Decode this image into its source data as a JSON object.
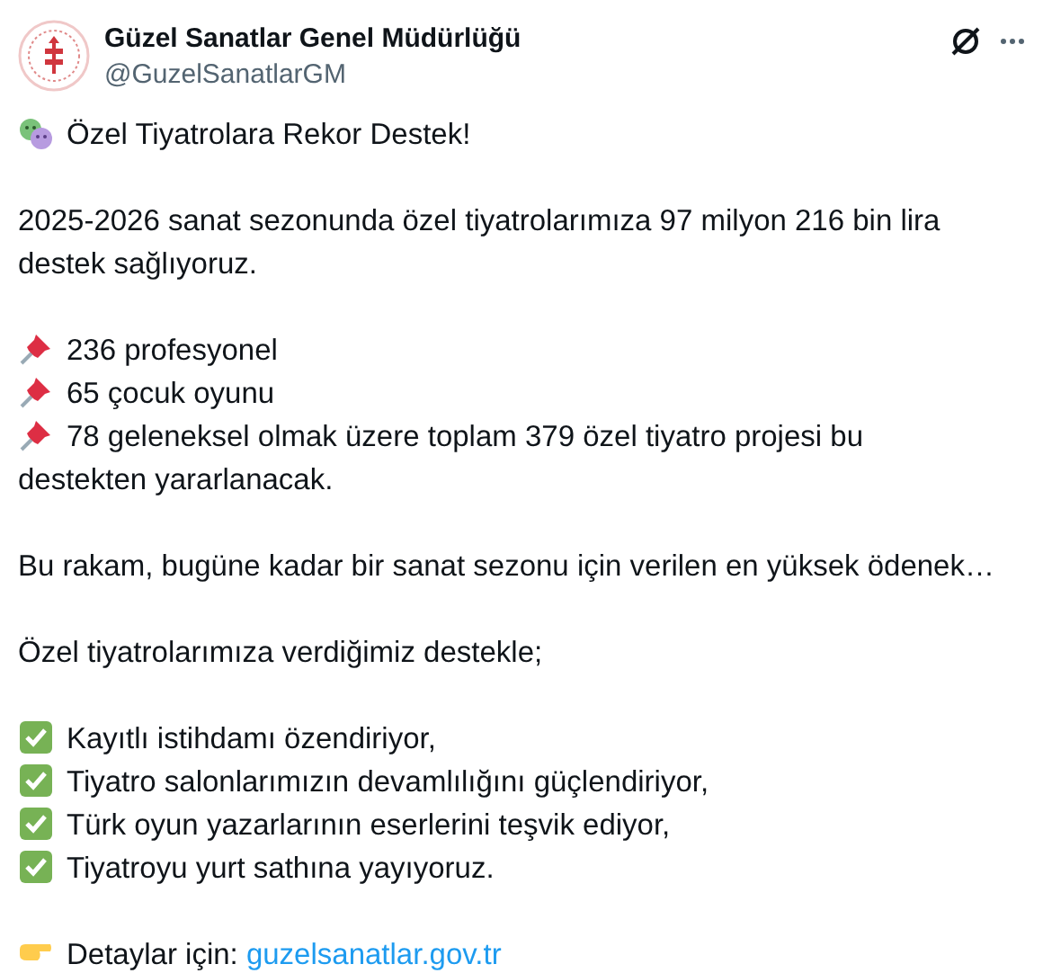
{
  "author": {
    "name": "Güzel Sanatlar Genel Müdürlüğü",
    "handle": "@GuzelSanatlarGM"
  },
  "paragraphs": [
    [
      {
        "kind": "masks",
        "text": "Özel Tiyatrolara Rekor Destek!"
      }
    ],
    [
      {
        "kind": "plain",
        "text": "2025-2026 sanat sezonunda özel tiyatrolarımıza 97 milyon 216 bin lira destek sağlıyoruz."
      }
    ],
    [
      {
        "kind": "pin",
        "text": "236 profesyonel"
      },
      {
        "kind": "pin",
        "text": "65 çocuk oyunu"
      },
      {
        "kind": "pin",
        "text": "78 geleneksel olmak üzere toplam 379 özel tiyatro projesi bu destekten yararlanacak."
      }
    ],
    [
      {
        "kind": "plain",
        "text": "Bu rakam, bugüne kadar bir sanat sezonu için verilen en yüksek ödenek…"
      }
    ],
    [
      {
        "kind": "plain",
        "text": "Özel tiyatrolarımıza verdiğimiz destekle;"
      }
    ],
    [
      {
        "kind": "check",
        "text": "Kayıtlı istihdamı özendiriyor,"
      },
      {
        "kind": "check",
        "text": "Tiyatro salonlarımızın devamlılığını güçlendiriyor,"
      },
      {
        "kind": "check",
        "text": "Türk oyun yazarlarının eserlerini teşvik ediyor,"
      },
      {
        "kind": "check",
        "text": "Tiyatroyu yurt sathına yayıyoruz."
      }
    ],
    [
      {
        "kind": "point",
        "text": "Detaylar için: ",
        "link": "guzelsanatlar.gov.tr"
      }
    ]
  ]
}
